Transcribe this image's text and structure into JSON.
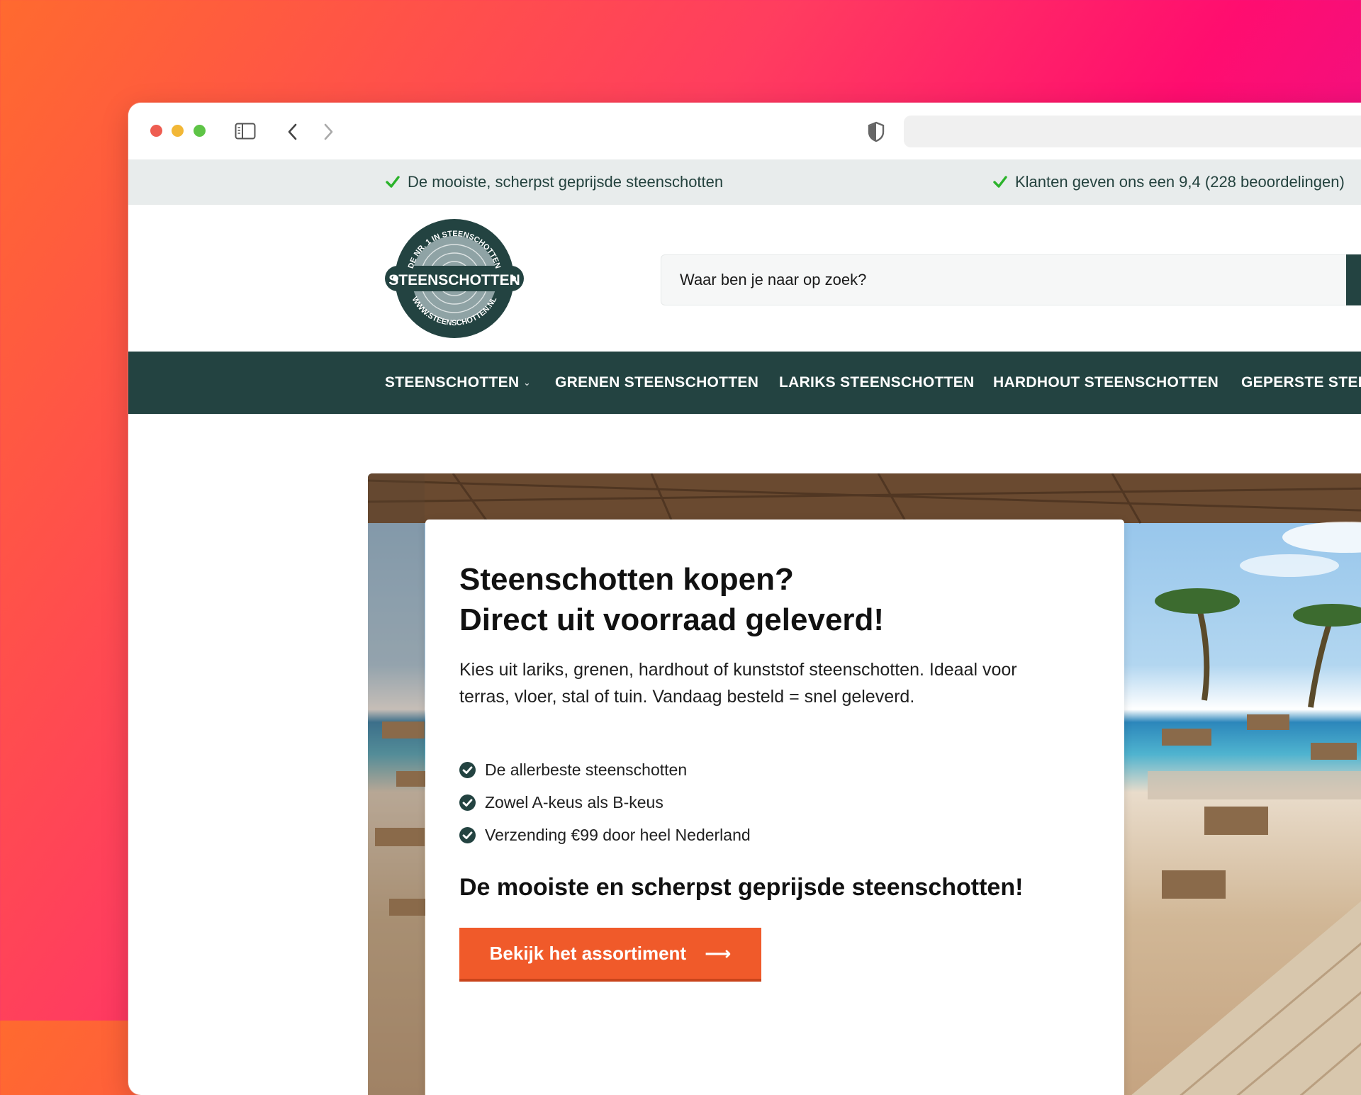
{
  "browser": {
    "icons": [
      "sidebar-icon",
      "back-icon",
      "forward-icon",
      "shield-icon"
    ],
    "address": ""
  },
  "topbar": {
    "usp_left": "De mooiste, scherpst geprijsde steenschotten",
    "usp_right": "Klanten geven ons een 9,4 (228 beoordelingen)"
  },
  "logo": {
    "top_text": "DE NR. 1 IN STEENSCHOTTEN",
    "band_text": "STEENSCHOTTEN",
    "bottom_text": "WWW.STEENSCHOTTEN.NL"
  },
  "search": {
    "placeholder": "Waar ben je naar op zoek?"
  },
  "nav": {
    "items": [
      {
        "label": "STEENSCHOTTEN"
      },
      {
        "label": "GRENEN STEENSCHOTTEN"
      },
      {
        "label": "LARIKS STEENSCHOTTEN"
      },
      {
        "label": "HARDHOUT STEENSCHOTTEN"
      },
      {
        "label": "GEPERSTE STEEN"
      }
    ]
  },
  "hero": {
    "title_line1": "Steenschotten kopen?",
    "title_line2": "Direct uit voorraad geleverd!",
    "intro": "Kies uit lariks, grenen, hardhout of kunststof steenschotten. Ideaal voor terras, vloer, stal of tuin. Vandaag besteld = snel geleverd.",
    "features": [
      "De allerbeste steenschotten",
      "Zowel A-keus als B-keus",
      "Verzending €99 door heel Nederland"
    ],
    "subtitle": "De mooiste en scherpst geprijsde steenschotten!",
    "cta_label": "Bekijk het assortiment",
    "cta_arrow": "⟶"
  },
  "colors": {
    "brand_dark": "#234341",
    "accent_orange": "#f05a2a",
    "check_green": "#2bb32b",
    "topbar_bg": "#e8ecec"
  }
}
